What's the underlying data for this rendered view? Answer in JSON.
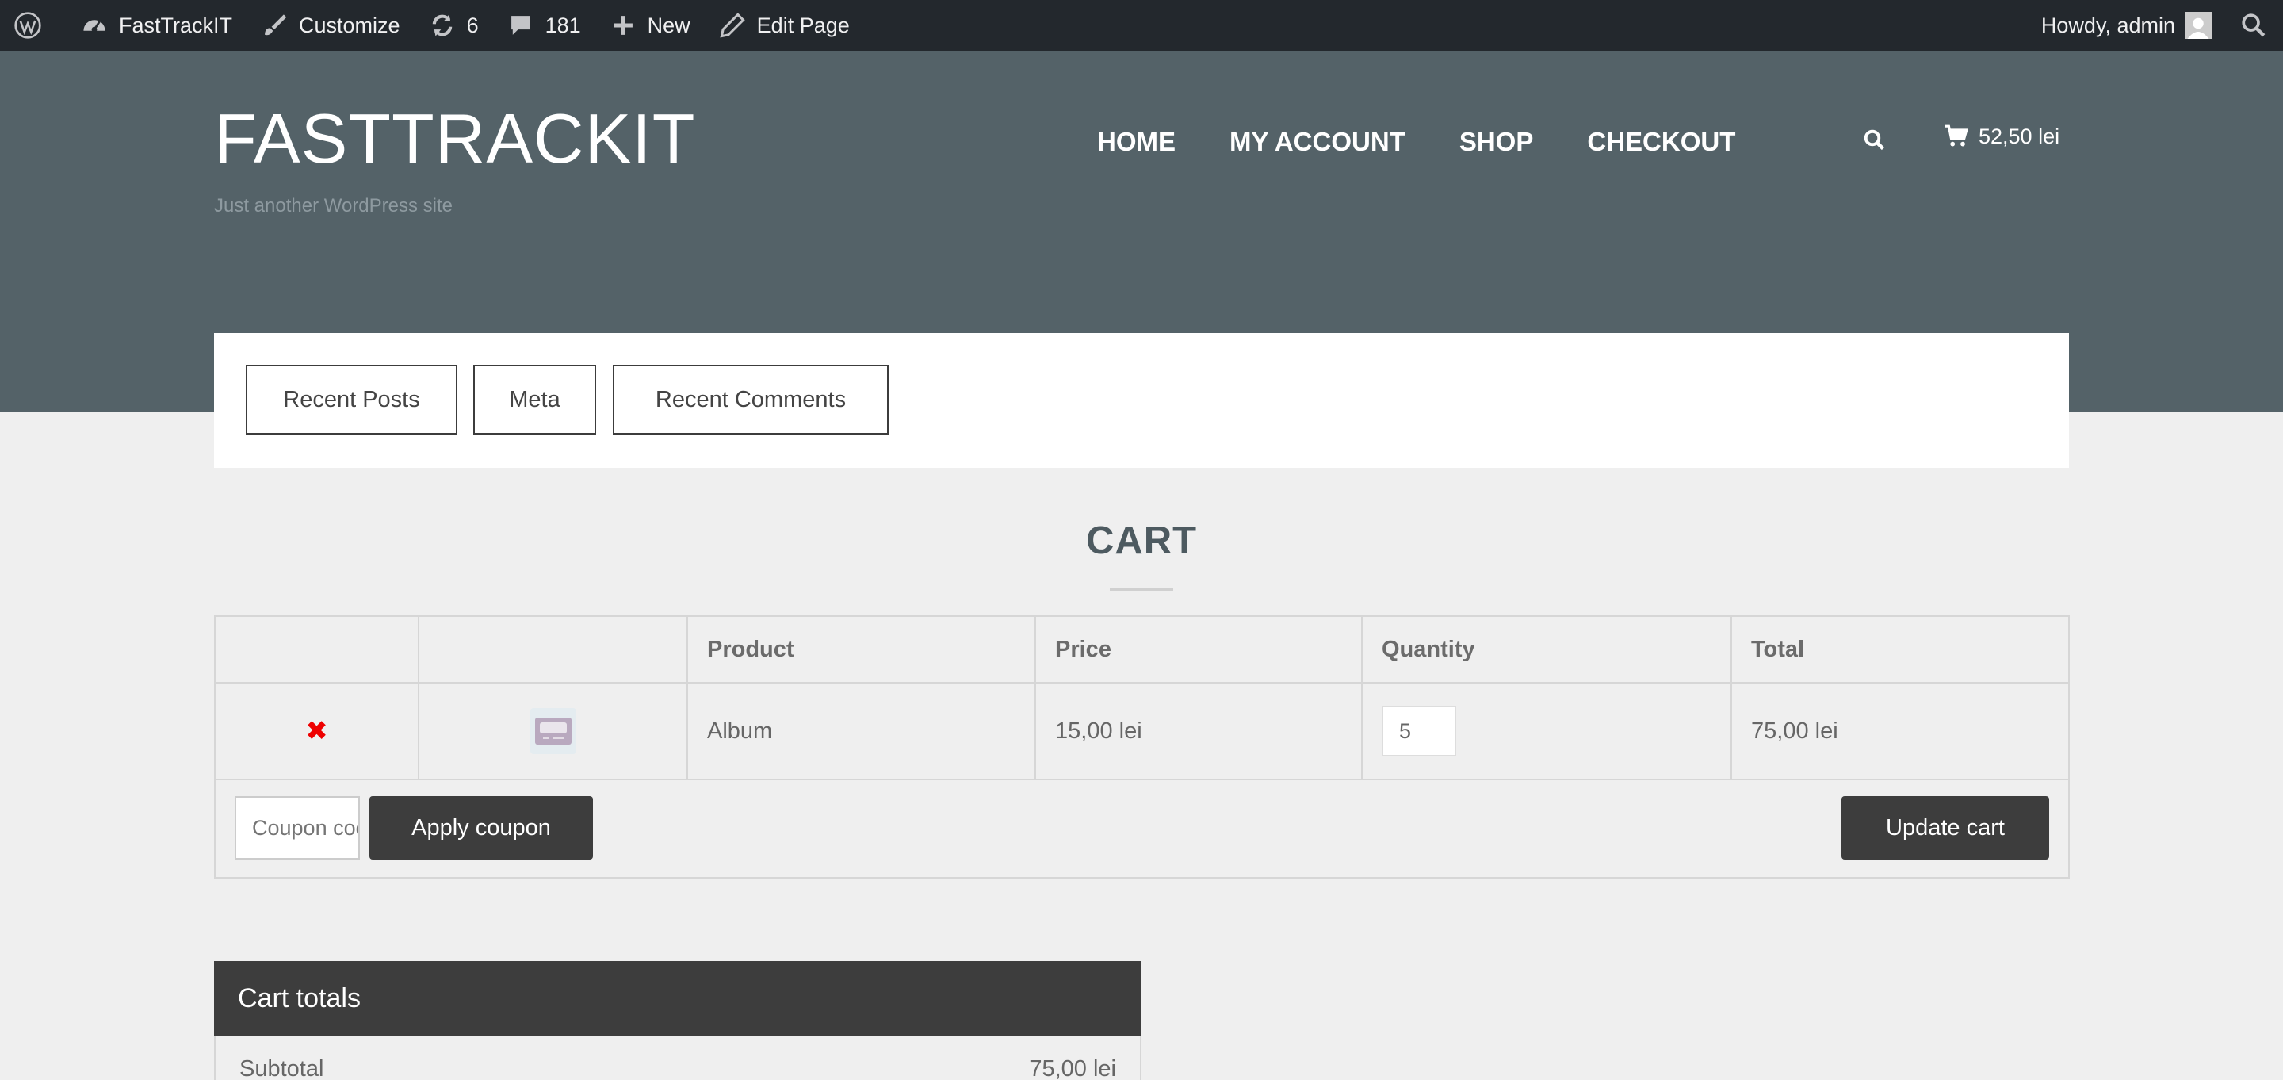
{
  "adminbar": {
    "site_name": "FastTrackIT",
    "customize": "Customize",
    "updates_count": "6",
    "comments_count": "181",
    "new_label": "New",
    "edit_page": "Edit Page",
    "howdy": "Howdy, admin"
  },
  "header": {
    "site_title": "FASTTRACKIT",
    "tagline": "Just another WordPress site",
    "nav": [
      "HOME",
      "MY ACCOUNT",
      "SHOP",
      "CHECKOUT"
    ],
    "cart_total": "52,50 lei"
  },
  "widgets": {
    "tabs": [
      "Recent Posts",
      "Meta",
      "Recent Comments"
    ]
  },
  "cart": {
    "title": "CART",
    "columns": [
      "",
      "",
      "Product",
      "Price",
      "Quantity",
      "Total"
    ],
    "items": [
      {
        "remove": "✖",
        "product": "Album",
        "price": "15,00 lei",
        "quantity": "5",
        "total": "75,00 lei"
      }
    ],
    "coupon_placeholder": "Coupon code",
    "apply_coupon": "Apply coupon",
    "update_cart": "Update cart"
  },
  "totals": {
    "title": "Cart totals",
    "subtotal_label": "Subtotal",
    "subtotal_value": "75,00 lei"
  },
  "colors": {
    "adminbar_bg": "#23282d",
    "header_bg": "#546268",
    "button_dark": "#3d3d3d",
    "remove_red": "#e00000"
  }
}
